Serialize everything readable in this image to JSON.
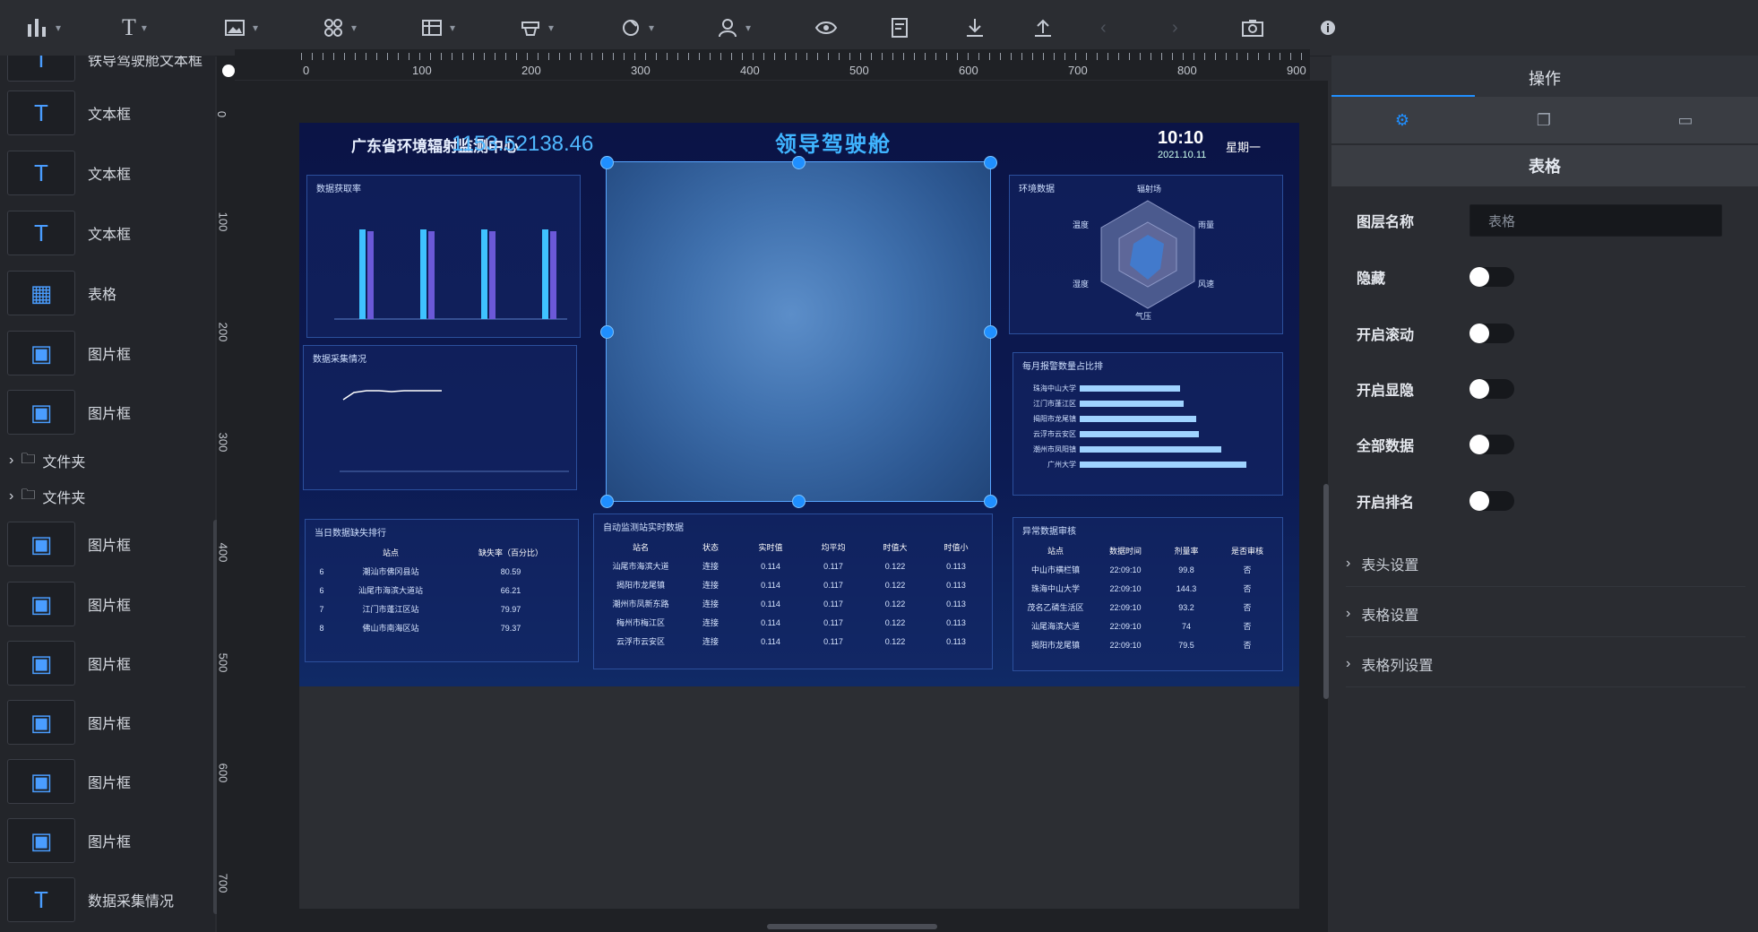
{
  "toolbar": {
    "items": [
      "chart-icon",
      "text-icon",
      "image-icon",
      "component-icon",
      "table-icon",
      "layer-icon",
      "settings-icon",
      "user-icon",
      "preview-icon",
      "notes-icon",
      "download-icon",
      "upload-icon",
      "undo-icon",
      "redo-icon",
      "screenshot-icon",
      "info-icon"
    ],
    "text_glyph": "T"
  },
  "layers": {
    "top_cut_label": "铁导驾驶舱文本框",
    "items": [
      {
        "icon": "text-icon",
        "label": "文本框"
      },
      {
        "icon": "text-icon",
        "label": "文本框"
      },
      {
        "icon": "text-icon",
        "label": "文本框"
      },
      {
        "icon": "table-icon",
        "label": "表格"
      },
      {
        "icon": "image-icon",
        "label": "图片框"
      },
      {
        "icon": "image-icon",
        "label": "图片框"
      }
    ],
    "folders": [
      {
        "label": "文件夹"
      },
      {
        "label": "文件夹"
      }
    ],
    "items2": [
      {
        "icon": "image-icon",
        "label": "图片框"
      },
      {
        "icon": "image-icon",
        "label": "图片框"
      },
      {
        "icon": "image-icon",
        "label": "图片框"
      },
      {
        "icon": "image-icon",
        "label": "图片框"
      },
      {
        "icon": "image-icon",
        "label": "图片框"
      },
      {
        "icon": "image-icon",
        "label": "图片框"
      },
      {
        "icon": "text-icon",
        "label": "数据采集情况"
      }
    ]
  },
  "rulers": {
    "horizontal": [
      "0",
      "100",
      "200",
      "300",
      "400",
      "500",
      "600",
      "700",
      "800",
      "900"
    ],
    "vertical": [
      "0",
      "100",
      "200",
      "300",
      "400",
      "500",
      "600",
      "700"
    ]
  },
  "dashboard": {
    "left_title": "广东省环境辐射监测中心",
    "overlay_value": "1153.52138.46",
    "main_title": "领导驾驶舱",
    "time": "10:10",
    "date": "2021.10.11",
    "weekday": "星期一",
    "panels": {
      "data_rate": "数据获取率",
      "env_data": "环境数据",
      "collection": "数据采集情况",
      "alarm_ratio": "每月报警数量占比排",
      "missing_rank": "当日数据缺失排行",
      "auto_station": "自动监测站实时数据",
      "abnormal": "异常数据审核"
    },
    "radar_labels": [
      "辐射场",
      "温度",
      "湿度",
      "气压",
      "风速",
      "雨量"
    ],
    "alarm_bars": [
      {
        "label": "珠海中山大学",
        "value": 160
      },
      {
        "label": "江门市蓬江区",
        "value": 165
      },
      {
        "label": "揭阳市龙尾镇",
        "value": 185
      },
      {
        "label": "云浮市云安区",
        "value": 190
      },
      {
        "label": "潮州市凤阳镇",
        "value": 225
      },
      {
        "label": "广州大学",
        "value": 265
      }
    ],
    "alarm_axis": [
      "0",
      "50",
      "100",
      "150",
      "200",
      "264",
      "300"
    ],
    "missing_table": {
      "headers": [
        "站点",
        "缺失率（百分比）"
      ],
      "rows": [
        [
          "6",
          "潮汕市佛冈县站",
          "80.59"
        ],
        [
          "6",
          "汕尾市海滨大道站",
          "66.21"
        ],
        [
          "7",
          "江门市蓬江区站",
          "79.97"
        ],
        [
          "8",
          "佛山市南海区站",
          "79.37"
        ]
      ]
    },
    "auto_table": {
      "headers": [
        "站名",
        "状态",
        "实时值",
        "均平均",
        "时值大",
        "时值小"
      ],
      "rows": [
        [
          "汕尾市海滨大道",
          "连接",
          "0.114",
          "0.117",
          "0.122",
          "0.113"
        ],
        [
          "揭阳市龙尾镇",
          "连接",
          "0.114",
          "0.117",
          "0.122",
          "0.113"
        ],
        [
          "潮州市凤新东路",
          "连接",
          "0.114",
          "0.117",
          "0.122",
          "0.113"
        ],
        [
          "梅州市梅江区",
          "连接",
          "0.114",
          "0.117",
          "0.122",
          "0.113"
        ],
        [
          "云浮市云安区",
          "连接",
          "0.114",
          "0.117",
          "0.122",
          "0.113"
        ]
      ]
    },
    "abnormal_table": {
      "headers": [
        "站点",
        "数据时间",
        "剂量率",
        "是否审核"
      ],
      "rows": [
        [
          "中山市横栏镇",
          "22:09:10",
          "99.8",
          "否"
        ],
        [
          "珠海中山大学",
          "22:09:10",
          "144.3",
          "否"
        ],
        [
          "茂名乙磷生活区",
          "22:09:10",
          "93.2",
          "否"
        ],
        [
          "汕尾海滨大道",
          "22:09:10",
          "74",
          "否"
        ],
        [
          "揭阳市龙尾镇",
          "22:09:10",
          "79.5",
          "否"
        ]
      ]
    }
  },
  "right_panel": {
    "header": "操作",
    "tabs": [
      "settings-icon",
      "copy-icon",
      "folder-icon"
    ],
    "section_title": "表格",
    "layer_name_label": "图层名称",
    "layer_name_placeholder": "表格",
    "toggles": [
      {
        "label": "隐藏",
        "on": false
      },
      {
        "label": "开启滚动",
        "on": false
      },
      {
        "label": "开启显隐",
        "on": false
      },
      {
        "label": "全部数据",
        "on": false
      },
      {
        "label": "开启排名",
        "on": false
      }
    ],
    "collapses": [
      "表头设置",
      "表格设置",
      "表格列设置"
    ]
  }
}
